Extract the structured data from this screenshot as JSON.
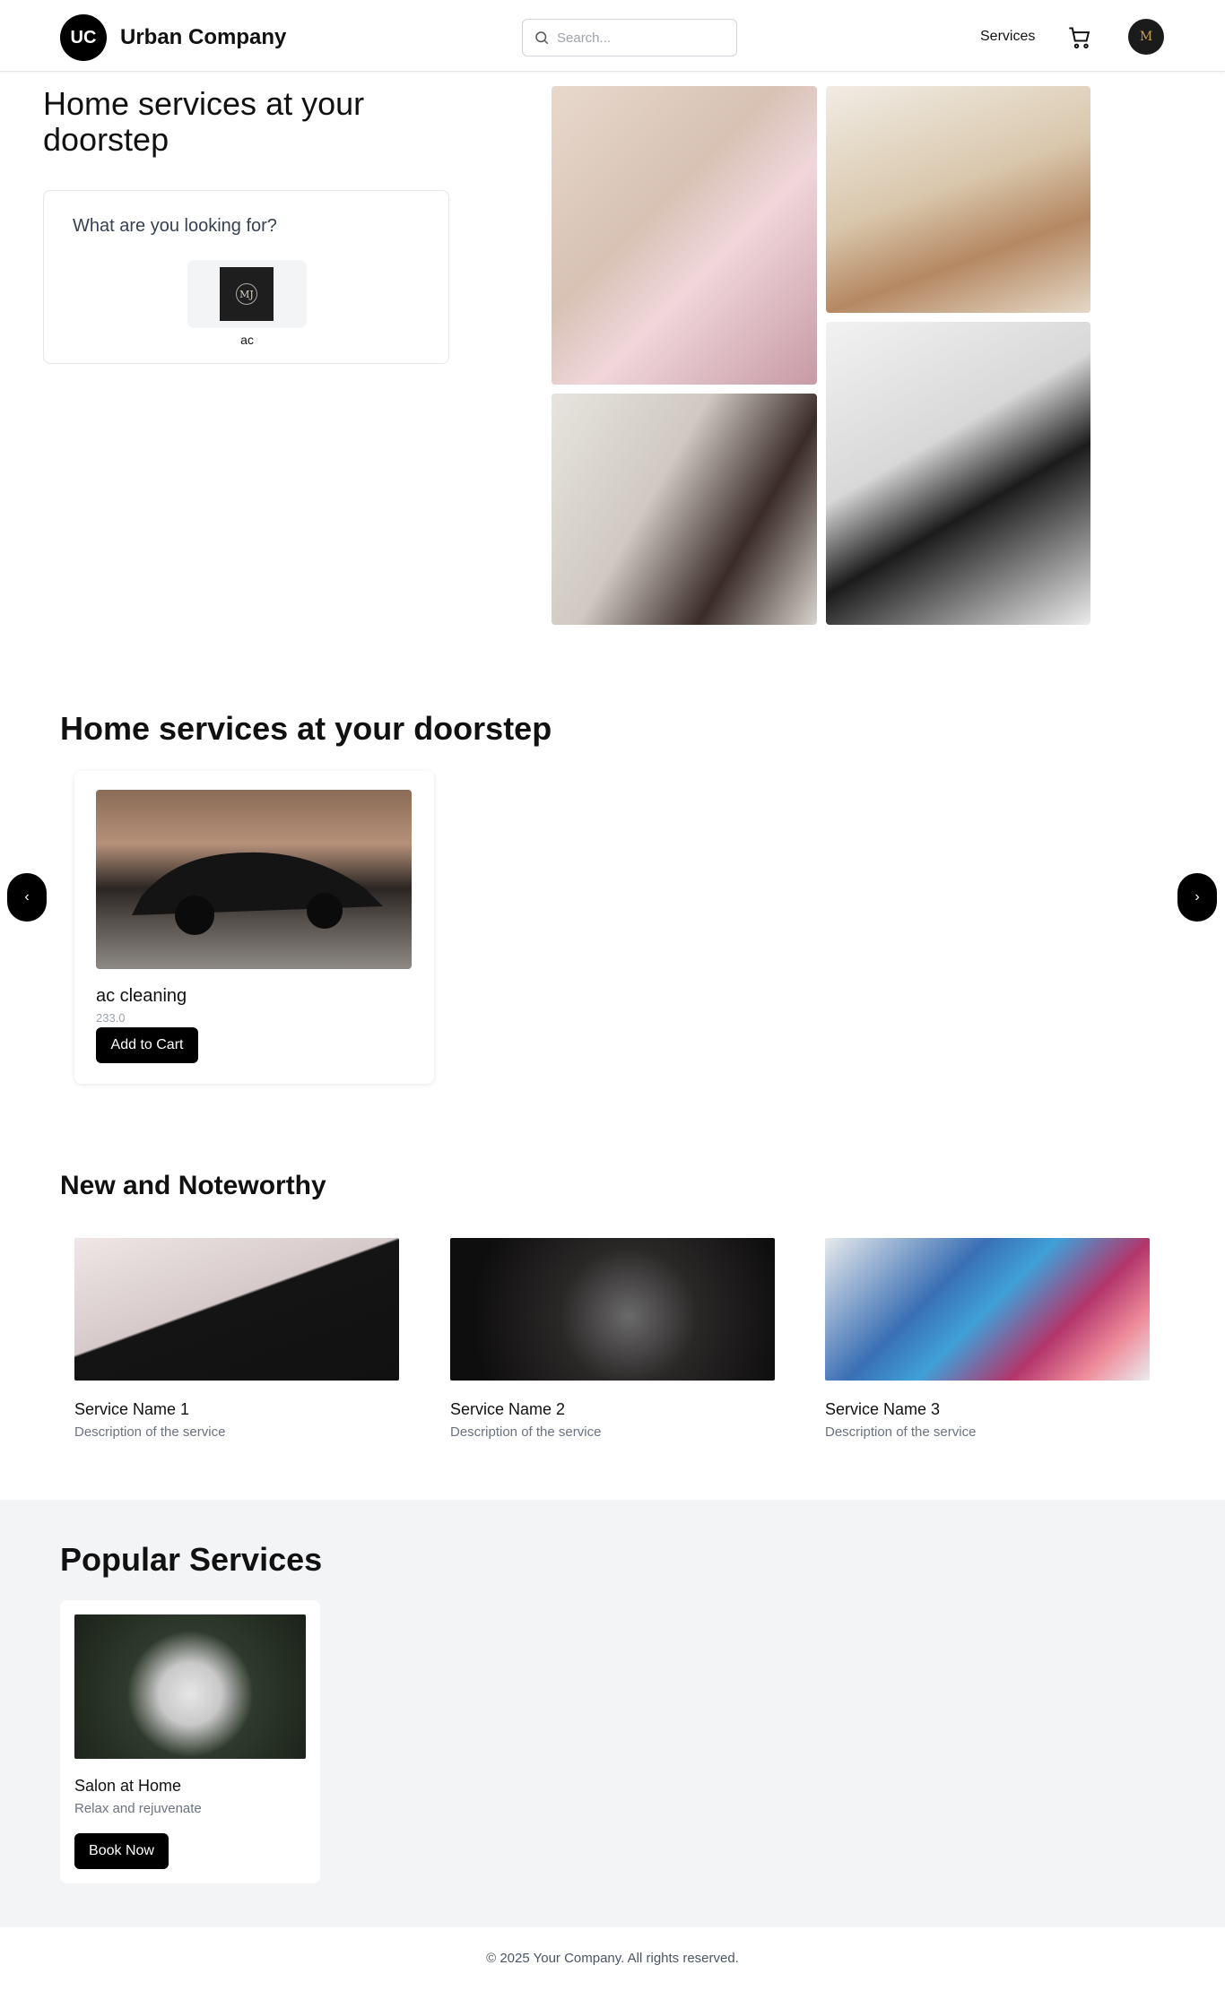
{
  "header": {
    "logo_initials": "UC",
    "brand": "Urban Company",
    "search_placeholder": "Search...",
    "nav_services": "Services",
    "avatar_text": "M"
  },
  "hero": {
    "title": "Home services at your doorstep",
    "lookup_title": "What are you looking for?",
    "lookup_item": {
      "label": "ac",
      "thumb_text": "MJ"
    }
  },
  "doorstep": {
    "title": "Home services at your doorstep",
    "prev_label": "‹",
    "next_label": "›",
    "card": {
      "name": "ac cleaning",
      "price": "233.0",
      "button": "Add to Cart"
    }
  },
  "noteworthy": {
    "title": "New and Noteworthy",
    "items": [
      {
        "name": "Service Name 1",
        "description": "Description of the service"
      },
      {
        "name": "Service Name 2",
        "description": "Description of the service"
      },
      {
        "name": "Service Name 3",
        "description": "Description of the service"
      }
    ]
  },
  "popular": {
    "title": "Popular Services",
    "card": {
      "name": "Salon at Home",
      "description": "Relax and rejuvenate",
      "button": "Book Now"
    }
  },
  "footer": {
    "text": "© 2025 Your Company. All rights reserved."
  },
  "colors": {
    "primary": "#000000",
    "muted_text": "#6b7280",
    "band_bg": "#f3f4f6",
    "border": "#e5e7eb"
  }
}
